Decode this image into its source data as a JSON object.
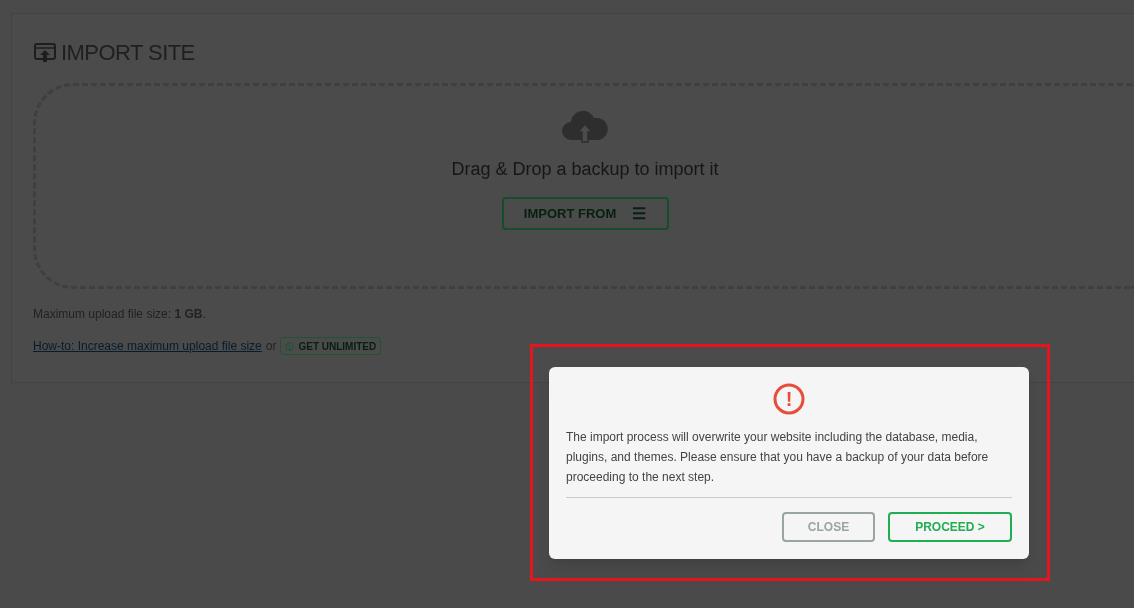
{
  "panel": {
    "title": "IMPORT SITE",
    "dropzone": {
      "text": "Drag & Drop a backup to import it",
      "button": "IMPORT FROM",
      "menu_glyph": "☰"
    },
    "max_size": "Maximum upload file size: **1 GB**.",
    "howto_link": "How-to: Increase maximum upload file size",
    "or_text": "or",
    "unlimited_badge": "GET UNLIMITED"
  },
  "dialog": {
    "icon": "!",
    "message": "The import process will overwrite your website including the database, media, plugins, and themes. Please ensure that you have a backup of your data before proceeding to the next step.",
    "buttons": [
      {
        "label": "CLOSE",
        "kind": "secondary"
      },
      {
        "label": "PROCEED >",
        "kind": "primary"
      }
    ]
  }
}
